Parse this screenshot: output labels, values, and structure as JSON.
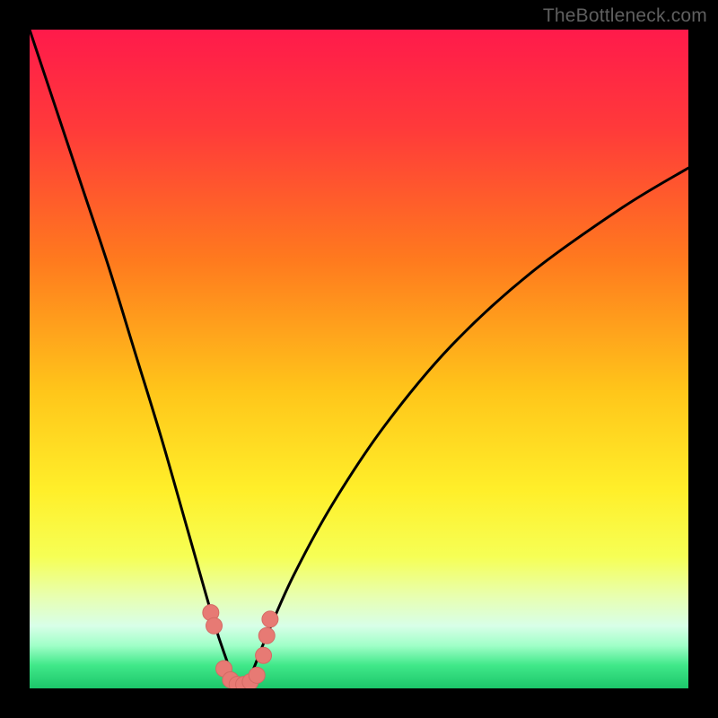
{
  "watermark": "TheBottleneck.com",
  "colors": {
    "black": "#000000",
    "gradient_stops": [
      {
        "offset": 0.0,
        "color": "#ff1a4b"
      },
      {
        "offset": 0.15,
        "color": "#ff3a3a"
      },
      {
        "offset": 0.35,
        "color": "#ff7a1e"
      },
      {
        "offset": 0.55,
        "color": "#ffc61a"
      },
      {
        "offset": 0.7,
        "color": "#ffef2a"
      },
      {
        "offset": 0.8,
        "color": "#f6ff55"
      },
      {
        "offset": 0.86,
        "color": "#e8ffb0"
      },
      {
        "offset": 0.905,
        "color": "#d8ffe8"
      },
      {
        "offset": 0.935,
        "color": "#a0ffc8"
      },
      {
        "offset": 0.965,
        "color": "#40e889"
      },
      {
        "offset": 1.0,
        "color": "#1cc66a"
      }
    ],
    "curve": "#000000",
    "marker_fill": "#e77a74",
    "marker_stroke": "#d46a64"
  },
  "chart_data": {
    "type": "line",
    "title": "",
    "xlabel": "",
    "ylabel": "",
    "xlim": [
      0,
      100
    ],
    "ylim": [
      0,
      100
    ],
    "note": "V-shaped bottleneck curve. y represents bottleneck % (0 at bottom/green, 100 at top/red). Minimum ~0 near x≈32.",
    "series": [
      {
        "name": "bottleneck-curve",
        "x": [
          0,
          4,
          8,
          12,
          16,
          20,
          24,
          28,
          30,
          31,
          32,
          33,
          34,
          36,
          40,
          46,
          54,
          64,
          76,
          90,
          100
        ],
        "y": [
          100,
          88,
          76,
          64,
          51,
          38,
          24,
          10,
          4,
          1,
          0,
          1,
          3,
          8,
          17,
          28,
          40,
          52,
          63,
          73,
          79
        ]
      }
    ],
    "markers": {
      "name": "highlight-dots",
      "x": [
        27.5,
        28.0,
        29.5,
        30.5,
        31.5,
        32.5,
        33.5,
        34.5,
        35.5,
        36.0,
        36.5
      ],
      "y": [
        11.5,
        9.5,
        3.0,
        1.3,
        0.6,
        0.6,
        1.0,
        2.0,
        5.0,
        8.0,
        10.5
      ]
    }
  }
}
